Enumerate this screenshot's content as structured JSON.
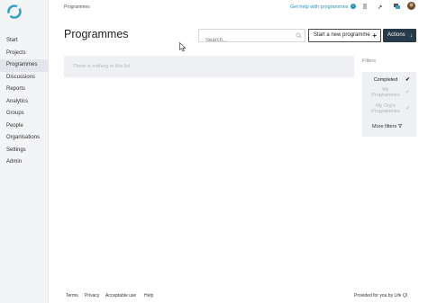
{
  "header": {
    "breadcrumb": "Programmes",
    "help_link": "Get help with programmes",
    "help_icon": "i"
  },
  "sidebar": {
    "items": [
      {
        "label": "Start"
      },
      {
        "label": "Projects"
      },
      {
        "label": "Programmes"
      },
      {
        "label": "Discussions"
      },
      {
        "label": "Reports"
      },
      {
        "label": "Analytics"
      },
      {
        "label": "Groups"
      },
      {
        "label": "People"
      },
      {
        "label": "Organisations"
      },
      {
        "label": "Settings"
      },
      {
        "label": "Admin"
      }
    ],
    "active": "Programmes"
  },
  "main": {
    "title": "Programmes",
    "search_placeholder": "Search...",
    "new_button": "Start a new programme",
    "new_button_icon": "+",
    "actions_button": "Actions",
    "actions_icon": "↓",
    "empty_message": "There is nothing in this list"
  },
  "filters": {
    "label": "Filters",
    "completed": "Completed",
    "my_programmes_1": "My",
    "my_programmes_2": "Programmes",
    "my_orgs_1": "My Org's",
    "my_orgs_2": "Programmes",
    "more_filters": "More filters",
    "check": "✔",
    "filter_icon": "∇"
  },
  "footer": {
    "terms": "Terms",
    "privacy": "Privacy",
    "acceptable_use": "Acceptable use",
    "help": "Help",
    "provided_by": "Provided for you by",
    "brand": "Life QI"
  },
  "colors": {
    "accent": "#2a8fbd",
    "dark_button": "#263a4a",
    "sidebar_bg": "#f3f4f6",
    "panel_bg": "#eef0f3"
  }
}
